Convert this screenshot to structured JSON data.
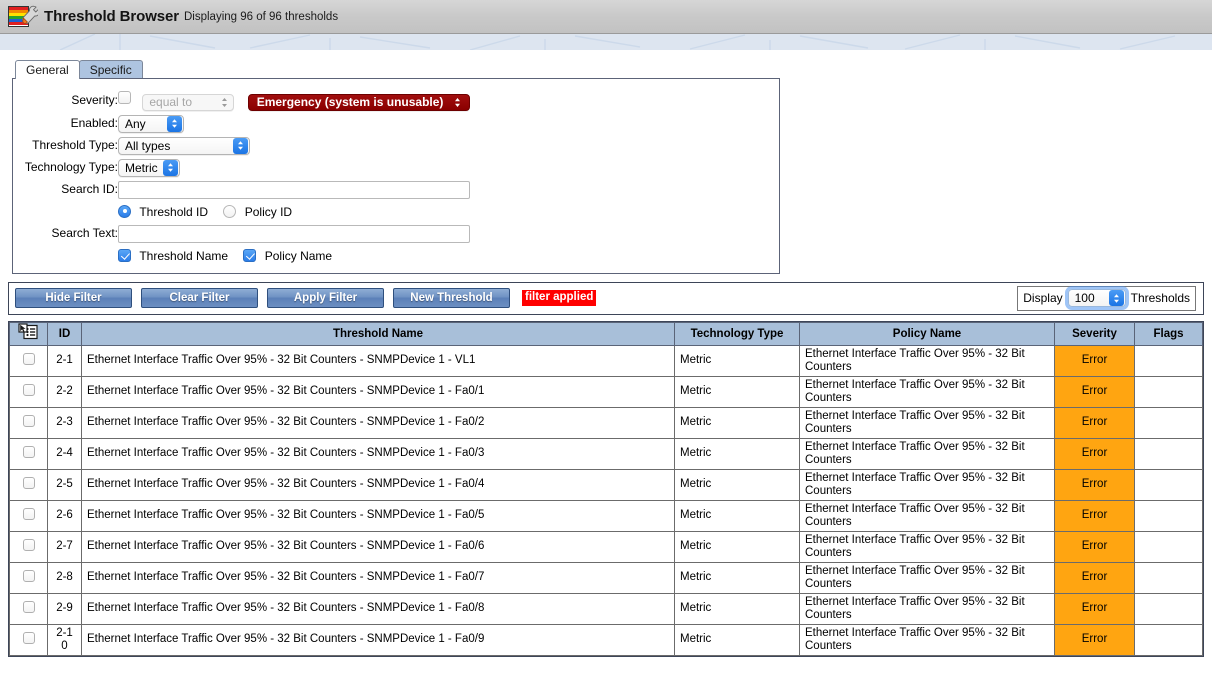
{
  "titlebar": {
    "app_title": "Threshold Browser",
    "status": "Displaying 96 of 96 thresholds",
    "icon": "chart-wrench-icon"
  },
  "tabs": [
    {
      "label": "General",
      "active": true
    },
    {
      "label": "Specific",
      "active": false
    }
  ],
  "filter": {
    "severity": {
      "label": "Severity:",
      "checkbox_checked": false,
      "operator": "equal to",
      "operator_disabled": true,
      "value": "Emergency (system is unusable)",
      "value_color": "#8a0000"
    },
    "enabled": {
      "label": "Enabled:",
      "value": "Any"
    },
    "threshold_type": {
      "label": "Threshold Type:",
      "value": "All types"
    },
    "technology_type": {
      "label": "Technology Type:",
      "value": "Metric"
    },
    "search_id": {
      "label": "Search ID:",
      "value": "",
      "placeholder": ""
    },
    "id_scope": [
      {
        "label": "Threshold ID",
        "selected": true
      },
      {
        "label": "Policy ID",
        "selected": false
      }
    ],
    "search_text": {
      "label": "Search Text:",
      "value": "",
      "placeholder": ""
    },
    "text_scope": [
      {
        "label": "Threshold Name",
        "checked": true
      },
      {
        "label": "Policy Name",
        "checked": true
      }
    ]
  },
  "toolbar": {
    "buttons": [
      {
        "label": "Hide Filter"
      },
      {
        "label": "Clear Filter"
      },
      {
        "label": "Apply Filter"
      },
      {
        "label": "New Threshold"
      }
    ],
    "filter_applied_badge": "filter applied",
    "badge_color": "#ff0000",
    "display_prefix": "Display",
    "display_count": "100",
    "display_suffix": "Thresholds"
  },
  "table": {
    "select_all_icon": "select-all-list-icon",
    "columns": [
      "",
      "ID",
      "Threshold Name",
      "Technology Type",
      "Policy Name",
      "Severity",
      "Flags"
    ],
    "rows": [
      {
        "id": "2-1",
        "name": "Ethernet Interface Traffic Over 95% - 32 Bit Counters - SNMPDevice 1 - VL1",
        "tech": "Metric",
        "policy": "Ethernet Interface Traffic Over 95% - 32 Bit Counters",
        "severity": "Error",
        "flags": ""
      },
      {
        "id": "2-2",
        "name": "Ethernet Interface Traffic Over 95% - 32 Bit Counters - SNMPDevice 1 - Fa0/1",
        "tech": "Metric",
        "policy": "Ethernet Interface Traffic Over 95% - 32 Bit Counters",
        "severity": "Error",
        "flags": ""
      },
      {
        "id": "2-3",
        "name": "Ethernet Interface Traffic Over 95% - 32 Bit Counters - SNMPDevice 1 - Fa0/2",
        "tech": "Metric",
        "policy": "Ethernet Interface Traffic Over 95% - 32 Bit Counters",
        "severity": "Error",
        "flags": ""
      },
      {
        "id": "2-4",
        "name": "Ethernet Interface Traffic Over 95% - 32 Bit Counters - SNMPDevice 1 - Fa0/3",
        "tech": "Metric",
        "policy": "Ethernet Interface Traffic Over 95% - 32 Bit Counters",
        "severity": "Error",
        "flags": ""
      },
      {
        "id": "2-5",
        "name": "Ethernet Interface Traffic Over 95% - 32 Bit Counters - SNMPDevice 1 - Fa0/4",
        "tech": "Metric",
        "policy": "Ethernet Interface Traffic Over 95% - 32 Bit Counters",
        "severity": "Error",
        "flags": ""
      },
      {
        "id": "2-6",
        "name": "Ethernet Interface Traffic Over 95% - 32 Bit Counters - SNMPDevice 1 - Fa0/5",
        "tech": "Metric",
        "policy": "Ethernet Interface Traffic Over 95% - 32 Bit Counters",
        "severity": "Error",
        "flags": ""
      },
      {
        "id": "2-7",
        "name": "Ethernet Interface Traffic Over 95% - 32 Bit Counters - SNMPDevice 1 - Fa0/6",
        "tech": "Metric",
        "policy": "Ethernet Interface Traffic Over 95% - 32 Bit Counters",
        "severity": "Error",
        "flags": ""
      },
      {
        "id": "2-8",
        "name": "Ethernet Interface Traffic Over 95% - 32 Bit Counters - SNMPDevice 1 - Fa0/7",
        "tech": "Metric",
        "policy": "Ethernet Interface Traffic Over 95% - 32 Bit Counters",
        "severity": "Error",
        "flags": ""
      },
      {
        "id": "2-9",
        "name": "Ethernet Interface Traffic Over 95% - 32 Bit Counters - SNMPDevice 1 - Fa0/8",
        "tech": "Metric",
        "policy": "Ethernet Interface Traffic Over 95% - 32 Bit Counters",
        "severity": "Error",
        "flags": ""
      },
      {
        "id": "2-10",
        "name": "Ethernet Interface Traffic Over 95% - 32 Bit Counters - SNMPDevice 1 - Fa0/9",
        "tech": "Metric",
        "policy": "Ethernet Interface Traffic Over 95% - 32 Bit Counters",
        "severity": "Error",
        "flags": ""
      }
    ],
    "severity_color": "#ffa511"
  }
}
